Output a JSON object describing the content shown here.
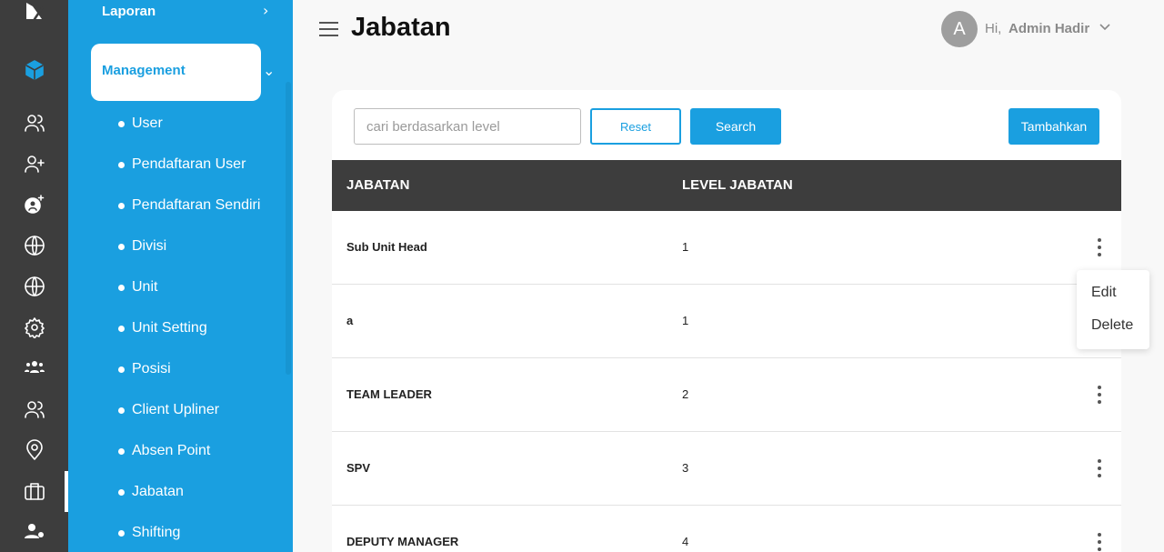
{
  "rail": {
    "icons": [
      "logo-icon",
      "cube-icon",
      "users-icon",
      "user-plus-icon",
      "user-gear-icon",
      "globe-icon",
      "globe-icon",
      "settings-icon",
      "group-icon",
      "users-icon",
      "location-pin-icon",
      "briefcase-icon",
      "user-settings-icon"
    ]
  },
  "sidebar": {
    "laporan": "Laporan",
    "management": "Management",
    "items": [
      "User",
      "Pendaftaran User",
      "Pendaftaran Sendiri",
      "Divisi",
      "Unit",
      "Unit Setting",
      "Posisi",
      "Client Upliner",
      "Absen Point",
      "Jabatan",
      "Shifting"
    ]
  },
  "header": {
    "title": "Jabatan",
    "avatar_letter": "A",
    "greeting": "Hi,",
    "user_name": "Admin Hadir"
  },
  "toolbar": {
    "search_placeholder": "cari berdasarkan level",
    "reset_label": "Reset",
    "search_label": "Search",
    "add_label": "Tambahkan"
  },
  "table": {
    "columns": [
      "JABATAN",
      "LEVEL JABATAN"
    ],
    "rows": [
      {
        "jabatan": "Sub Unit Head",
        "level": "1"
      },
      {
        "jabatan": "a",
        "level": "1"
      },
      {
        "jabatan": "TEAM LEADER",
        "level": "2"
      },
      {
        "jabatan": "SPV",
        "level": "3"
      },
      {
        "jabatan": "DEPUTY MANAGER",
        "level": "4"
      }
    ]
  },
  "row_menu": {
    "edit": "Edit",
    "delete": "Delete"
  },
  "colors": {
    "accent": "#1a9fe0",
    "rail": "#3d3d3d",
    "table_header": "#3d3d3d"
  }
}
